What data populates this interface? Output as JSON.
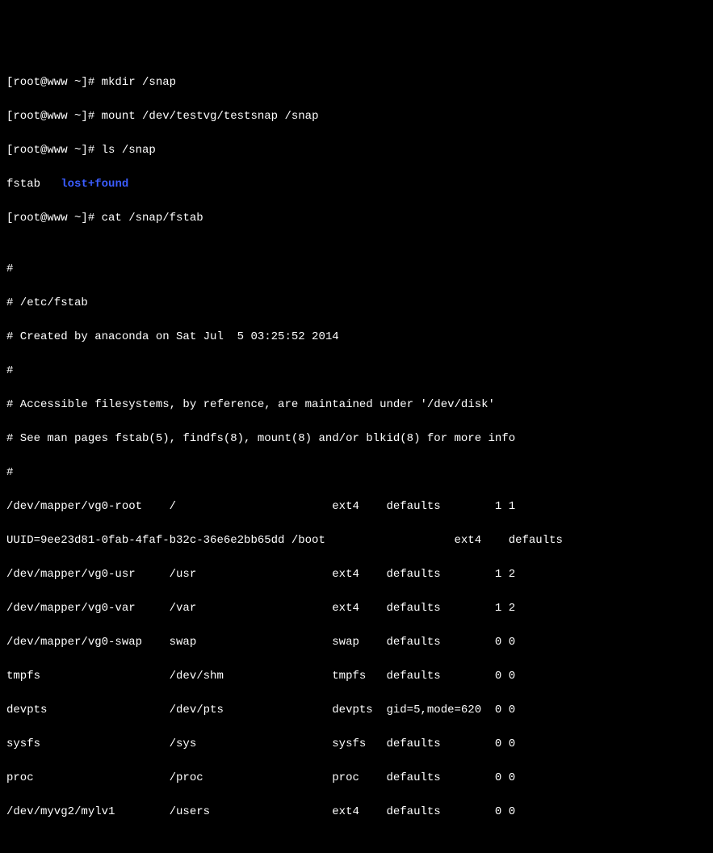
{
  "prompt": "[root@www ~]# ",
  "commands": {
    "mkdir": "mkdir /snap",
    "mount": "mount /dev/testvg/testsnap /snap",
    "ls": "ls /snap",
    "cat": "cat /snap/fstab"
  },
  "ls_output": {
    "fstab": "fstab",
    "spacer": "   ",
    "lostfound": "lost+found"
  },
  "fstab_lines": {
    "blank1": "",
    "hash1": "#",
    "hash2": "# /etc/fstab",
    "hash3": "# Created by anaconda on Sat Jul  5 03:25:52 2014",
    "hash4": "#",
    "hash5": "# Accessible filesystems, by reference, are maintained under '/dev/disk'",
    "hash6": "# See man pages fstab(5), findfs(8), mount(8) and/or blkid(8) for more info",
    "hash7": "#",
    "row1": "/dev/mapper/vg0-root    /                       ext4    defaults        1 1",
    "row2": "UUID=9ee23d81-0fab-4faf-b32c-36e6e2bb65dd /boot                   ext4    defaults",
    "row3": "/dev/mapper/vg0-usr     /usr                    ext4    defaults        1 2",
    "row4": "/dev/mapper/vg0-var     /var                    ext4    defaults        1 2",
    "row5": "/dev/mapper/vg0-swap    swap                    swap    defaults        0 0",
    "row6": "tmpfs                   /dev/shm                tmpfs   defaults        0 0",
    "row7": "devpts                  /dev/pts                devpts  gid=5,mode=620  0 0",
    "row8": "sysfs                   /sys                    sysfs   defaults        0 0",
    "row9": "proc                    /proc                   proc    defaults        0 0",
    "row10": "/dev/myvg2/mylv1        /users                  ext4    defaults        0 0"
  }
}
